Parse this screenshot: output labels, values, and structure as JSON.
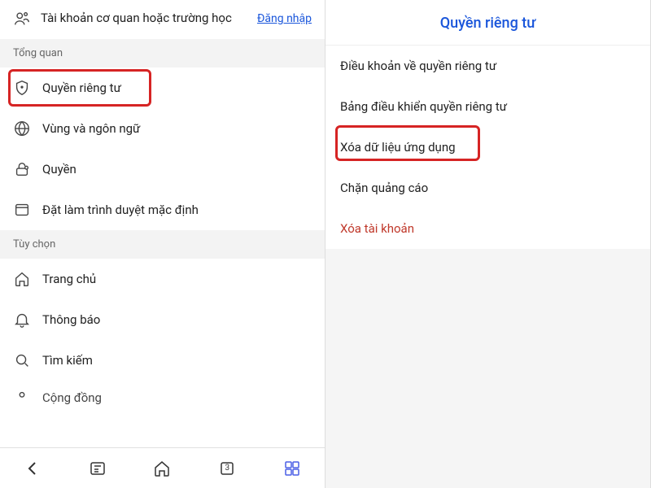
{
  "left": {
    "account": {
      "title": "Tài khoản cơ quan hoặc trường học",
      "signin": "Đăng nhập"
    },
    "sections": {
      "overview": "Tổng quan",
      "options": "Tùy chọn"
    },
    "items": {
      "privacy": "Quyền riêng tư",
      "region": "Vùng và ngôn ngữ",
      "permissions": "Quyền",
      "default_browser": "Đặt làm trình duyệt mặc định",
      "home": "Trang chủ",
      "notifications": "Thông báo",
      "search": "Tìm kiếm",
      "community": "Cộng đồng"
    },
    "tabs_count": "3"
  },
  "right": {
    "title": "Quyền riêng tư",
    "items": {
      "terms": "Điều khoản về quyền riêng tư",
      "dashboard": "Bảng điều khiển quyền riêng tư",
      "clear_data": "Xóa dữ liệu ứng dụng",
      "block_ads": "Chặn quảng cáo",
      "delete_account": "Xóa tài khoản"
    }
  }
}
